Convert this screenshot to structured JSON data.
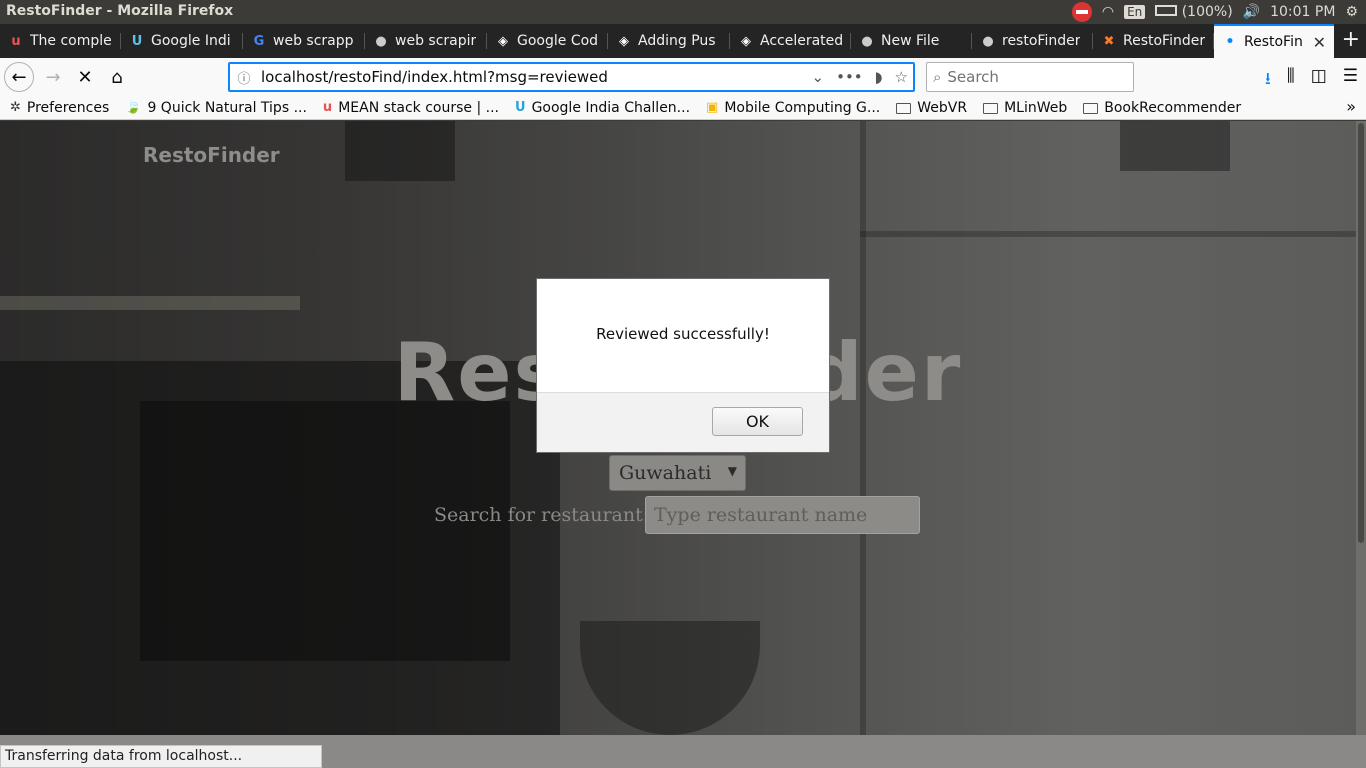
{
  "os": {
    "window_title": "RestoFinder - Mozilla Firefox",
    "keyboard_layout": "En",
    "battery": "(100%)",
    "clock": "10:01 PM"
  },
  "tabs": [
    {
      "label": "The comple",
      "favicon": "udemy-icon",
      "glyph": "u",
      "color": "#ec5252"
    },
    {
      "label": "Google Indi",
      "favicon": "hackerearth-icon",
      "glyph": "U",
      "color": "#5bc0eb"
    },
    {
      "label": "web scrapp",
      "favicon": "google-icon",
      "glyph": "G",
      "color": "#4285f4"
    },
    {
      "label": "web scrapir",
      "favicon": "github-icon",
      "glyph": "●",
      "color": "#cccccc"
    },
    {
      "label": "Google Cod",
      "favicon": "web-icon",
      "glyph": "◈",
      "color": "#ffffff"
    },
    {
      "label": "Adding Pus",
      "favicon": "web-icon",
      "glyph": "◈",
      "color": "#ffffff"
    },
    {
      "label": "Accelerated",
      "favicon": "web-icon",
      "glyph": "◈",
      "color": "#ffffff"
    },
    {
      "label": "New File",
      "favicon": "github-icon",
      "glyph": "●",
      "color": "#cccccc"
    },
    {
      "label": "restoFinder",
      "favicon": "github-icon",
      "glyph": "●",
      "color": "#cccccc"
    },
    {
      "label": "RestoFinder",
      "favicon": "xampp-icon",
      "glyph": "✖",
      "color": "#fb7a24"
    },
    {
      "label": "RestoFin",
      "favicon": "loading-dot-icon",
      "glyph": "•",
      "color": "#0a84ff",
      "active": true
    }
  ],
  "navbar": {
    "url": "localhost/restoFind/index.html?msg=reviewed",
    "search_placeholder": "Search"
  },
  "bookmarks": [
    {
      "label": "Preferences",
      "icon": "gear-icon",
      "glyph": "✲",
      "color": "#333333"
    },
    {
      "label": "9 Quick Natural Tips ...",
      "icon": "leaf-icon",
      "glyph": "🍃",
      "color": "#6ab04c"
    },
    {
      "label": "MEAN stack course | ...",
      "icon": "udemy-icon",
      "glyph": "u",
      "color": "#ec5252"
    },
    {
      "label": "Google India Challen...",
      "icon": "hackerearth-icon",
      "glyph": "U",
      "color": "#2aa3d8"
    },
    {
      "label": "Mobile Computing G...",
      "icon": "classroom-icon",
      "glyph": "▣",
      "color": "#f4b400"
    },
    {
      "label": "WebVR",
      "icon": "folder-icon"
    },
    {
      "label": "MLinWeb",
      "icon": "folder-icon"
    },
    {
      "label": "BookRecommender",
      "icon": "folder-icon"
    }
  ],
  "page": {
    "brand": "RestoFinder",
    "hero_title": "RestoFinder",
    "city_selected": "Guwahati",
    "search_label": "Search for restaurant:",
    "search_placeholder": "Type restaurant name"
  },
  "dialog": {
    "message": "Reviewed successfully!",
    "ok_label": "OK"
  },
  "status": {
    "text": "Transferring data from localhost..."
  }
}
